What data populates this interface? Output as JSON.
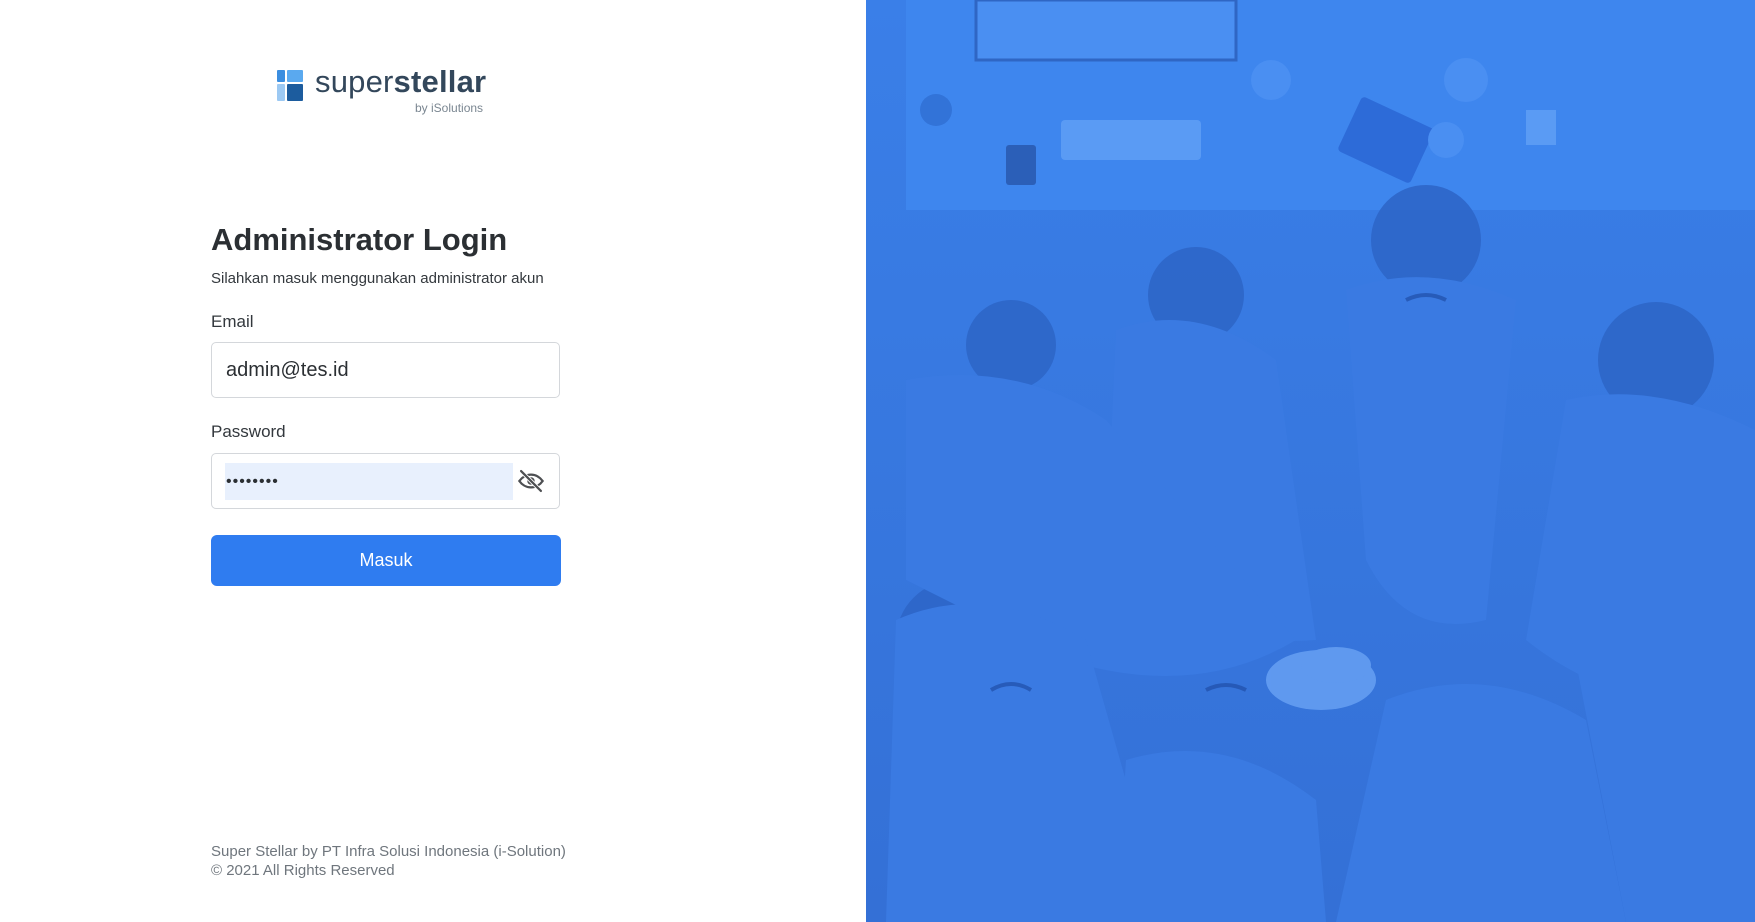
{
  "brand": {
    "name_light": "super",
    "name_bold": "stellar",
    "byline": "by iSolutions"
  },
  "login": {
    "title": "Administrator Login",
    "subtitle": "Silahkan masuk menggunakan administrator akun",
    "email_label": "Email",
    "email_value": "admin@tes.id",
    "password_label": "Password",
    "password_value": "password",
    "submit_label": "Masuk"
  },
  "footer": {
    "line1": "Super Stellar by PT Infra Solusi Indonesia (i-Solution)",
    "line2": "© 2021 All Rights Reserved"
  },
  "colors": {
    "primary_button": "#2f7cf0",
    "photo_overlay": "#3b7de6",
    "autofill_bg": "#e8f0fd"
  },
  "icons": {
    "password_toggle": "eye-off-icon"
  }
}
